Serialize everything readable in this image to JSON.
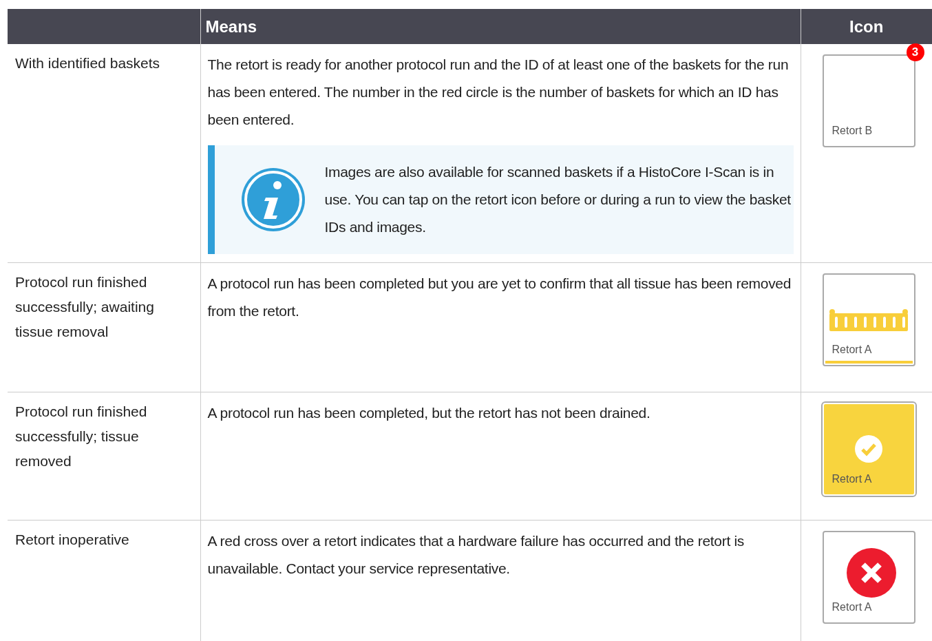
{
  "table": {
    "columns": {
      "means": "Means",
      "icon": "Icon"
    },
    "rows": [
      {
        "state": "With identified baskets",
        "means": "The retort is ready for another protocol run and the ID of at least one of the baskets for the run has been entered. The number in the red circle is the number of baskets for which an ID has been entered.",
        "note": "Images are also available for scanned baskets if a HistoCore I-Scan is in use. You can tap on the retort icon before or during a run to view the basket IDs and images.",
        "icon": {
          "kind": "empty",
          "label": "Retort B",
          "badge": "3"
        }
      },
      {
        "state": "Protocol run finished successfully; awaiting tissue removal",
        "means": "A protocol run has been completed but you are yet to confirm that all tissue has been removed from the retort.",
        "icon": {
          "kind": "basket",
          "label": "Retort A",
          "level": 1
        }
      },
      {
        "state": "Protocol run finished successfully; tissue removed",
        "means": "A protocol run has been completed, but the retort has not been drained.",
        "icon": {
          "kind": "done",
          "label": "Retort A"
        }
      },
      {
        "state": "Retort inoperative",
        "means": "A red cross over a retort indicates that a hardware failure has occurred and the retort is unavailable. Contact your service representative.",
        "icon": {
          "kind": "error",
          "label": "Retort A"
        }
      }
    ]
  }
}
